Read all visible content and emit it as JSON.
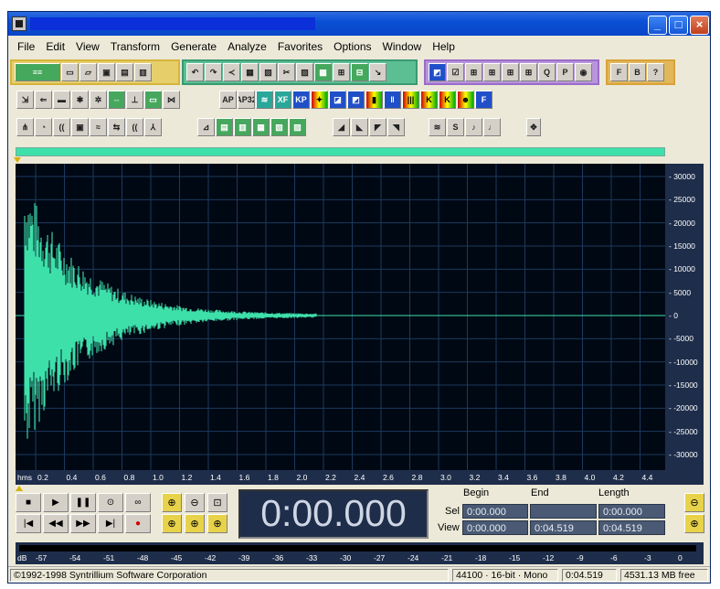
{
  "window": {
    "title": ""
  },
  "menu": [
    "File",
    "Edit",
    "View",
    "Transform",
    "Generate",
    "Analyze",
    "Favorites",
    "Options",
    "Window",
    "Help"
  ],
  "toolbar": {
    "row1_group4": [
      "F",
      "B",
      "?"
    ],
    "row2_icons": [
      "AP",
      "AP32",
      "XF",
      "KP"
    ]
  },
  "waveform": {
    "amplitude_labels": [
      "30000",
      "25000",
      "20000",
      "15000",
      "10000",
      "5000",
      "0",
      "-5000",
      "-10000",
      "-15000",
      "-20000",
      "-25000",
      "-30000"
    ],
    "time_labels": [
      "hms",
      "0.2",
      "0.4",
      "0.6",
      "0.8",
      "1.0",
      "1.2",
      "1.4",
      "1.6",
      "1.8",
      "2.0",
      "2.2",
      "2.4",
      "2.6",
      "2.8",
      "3.0",
      "3.2",
      "3.4",
      "3.6",
      "3.8",
      "4.0",
      "4.2",
      "4.4"
    ],
    "color": "#3ee0aa",
    "background": "#000814"
  },
  "transport": {
    "time": "0:00.000"
  },
  "selection": {
    "headers": {
      "begin": "Begin",
      "end": "End",
      "length": "Length"
    },
    "sel_label": "Sel",
    "view_label": "View",
    "sel": {
      "begin": "0:00.000",
      "end": "",
      "length": "0:00.000"
    },
    "view": {
      "begin": "0:00.000",
      "end": "0:04.519",
      "length": "0:04.519"
    }
  },
  "level_meter": {
    "labels": [
      "dB",
      "-57",
      "-54",
      "-51",
      "-48",
      "-45",
      "-42",
      "-39",
      "-36",
      "-33",
      "-30",
      "-27",
      "-24",
      "-21",
      "-18",
      "-15",
      "-12",
      "-9",
      "-6",
      "-3",
      "0"
    ]
  },
  "status": {
    "copyright": "©1992-1998 Syntrillium Software Corporation",
    "format": "44100 · 16-bit · Mono",
    "duration": "0:04.519",
    "free": "4531.13 MB free"
  }
}
